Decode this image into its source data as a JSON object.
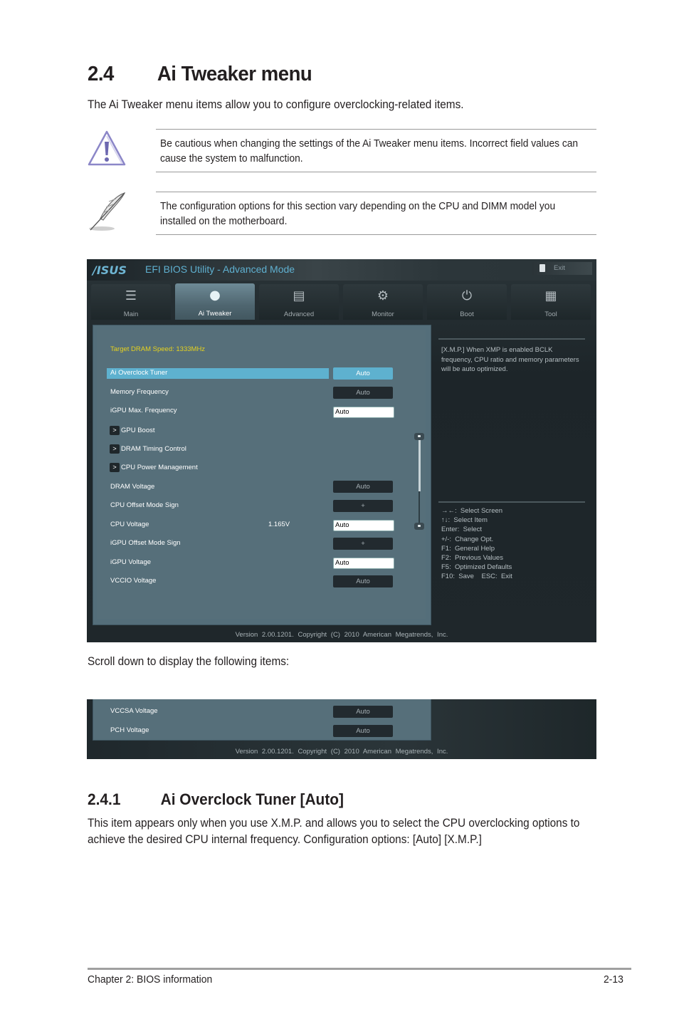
{
  "section": {
    "number": "2.4",
    "title": "Ai Tweaker menu",
    "intro": "The Ai Tweaker menu items allow you to configure overclocking-related items."
  },
  "notes": [
    {
      "icon": "warning-icon",
      "text": "Be cautious when changing the settings of the Ai Tweaker menu items. Incorrect field values can cause the system to malfunction."
    },
    {
      "icon": "note-feather-icon",
      "text": "The configuration options for this section vary depending on the CPU and DIMM model you installed on the motherboard."
    }
  ],
  "bios": {
    "logo": "/ISUS",
    "title": "EFI BIOS Utility - Advanced Mode",
    "exit_label": "Exit",
    "tabs": [
      {
        "label": "Main",
        "icon": "list-icon",
        "active": false
      },
      {
        "label": "Ai  Tweaker",
        "icon": "ai-tweaker-icon",
        "active": true
      },
      {
        "label": "Advanced",
        "icon": "advanced-icon",
        "active": false
      },
      {
        "label": "Monitor",
        "icon": "monitor-icon",
        "active": false
      },
      {
        "label": "Boot",
        "icon": "power-icon",
        "active": false
      },
      {
        "label": "Tool",
        "icon": "tool-icon",
        "active": false
      }
    ],
    "target_dram": "Target DRAM Speed: 1333MHz",
    "items": [
      {
        "label": "Ai Overclock Tuner",
        "value": "Auto",
        "type": "selected"
      },
      {
        "label": "Memory Frequency",
        "value": "Auto",
        "type": "button"
      },
      {
        "label": "iGPU Max. Frequency",
        "value": "Auto",
        "type": "input"
      },
      {
        "label": "GPU Boost",
        "type": "submenu"
      },
      {
        "label": "DRAM Timing Control",
        "type": "submenu"
      },
      {
        "label": "CPU Power Management",
        "type": "submenu"
      },
      {
        "label": "DRAM Voltage",
        "value": "Auto",
        "type": "button"
      },
      {
        "label": "CPU Offset Mode Sign",
        "value": "+",
        "type": "button"
      },
      {
        "label": "CPU Voltage",
        "reading": "1.165V",
        "value": "Auto",
        "type": "input"
      },
      {
        "label": "iGPU Offset Mode Sign",
        "value": "+",
        "type": "button"
      },
      {
        "label": "iGPU Voltage",
        "value": "Auto",
        "type": "input"
      },
      {
        "label": "VCCIO Voltage",
        "value": "Auto",
        "type": "button"
      }
    ],
    "help_text": "[X.M.P.] When XMP is enabled BCLK frequency, CPU ratio and memory parameters will be auto optimized.",
    "keys": [
      "→←:  Select Screen",
      "↑↓:  Select Item",
      "Enter:  Select",
      "+/-:  Change Opt.",
      "F1:  General Help",
      "F2:  Previous Values",
      "F5:  Optimized Defaults",
      "F10:  Save    ESC:  Exit"
    ],
    "version": "Version  2.00.1201.  Copyright  (C)  2010  American  Megatrends,  Inc."
  },
  "scroll_caption": "Scroll down to display the following items:",
  "bios2": {
    "items": [
      {
        "label": "VCCSA Voltage",
        "value": "Auto"
      },
      {
        "label": "PCH Voltage",
        "value": "Auto"
      }
    ],
    "version": "Version  2.00.1201.  Copyright  (C)  2010  American  Megatrends,  Inc."
  },
  "subsection": {
    "number": "2.4.1",
    "title": "Ai Overclock Tuner [Auto]",
    "body": "This item appears only when you use X.M.P. and allows you to select the CPU overclocking options to achieve the desired CPU internal frequency. Configuration options: [Auto] [X.M.P.]"
  },
  "footer": {
    "chapter": "Chapter 2: BIOS information",
    "page": "2-13"
  }
}
